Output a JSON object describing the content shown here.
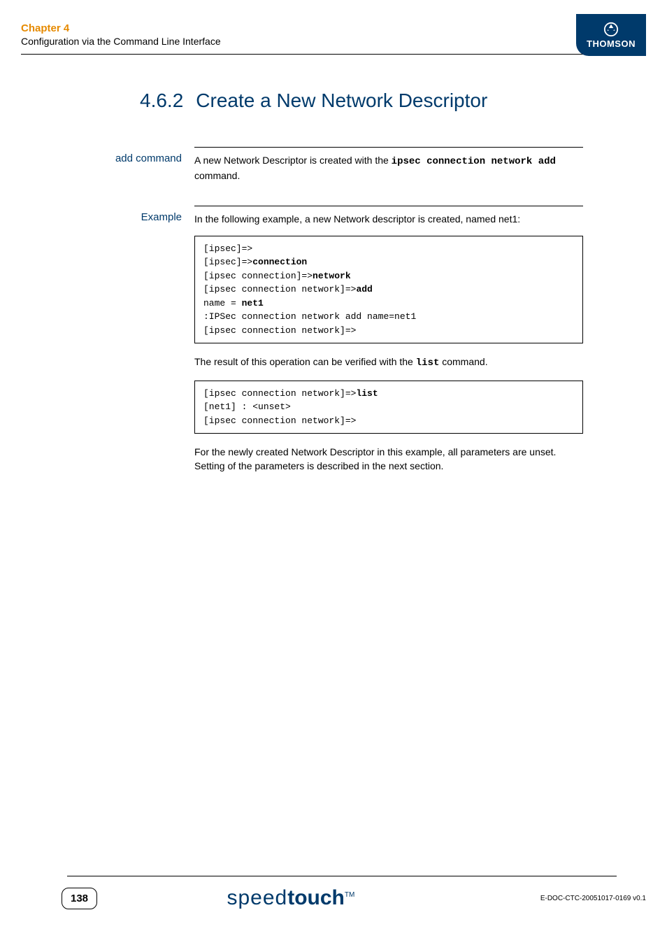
{
  "header": {
    "chapter_label": "Chapter 4",
    "chapter_subtitle": "Configuration via the Command Line Interface",
    "brand": "THOMSON"
  },
  "title": {
    "number": "4.6.2",
    "text": "Create a New Network Descriptor"
  },
  "sections": {
    "add_command": {
      "label": "add command",
      "para_prefix": "A new Network Descriptor is created with the ",
      "cmd": "ipsec connection network add",
      "para_suffix": " command."
    },
    "example": {
      "label": "Example",
      "intro": "In the following example, a new Network descriptor is created, named net1:",
      "code1": {
        "l1": "[ipsec]=>",
        "l2a": "[ipsec]=>",
        "l2b": "connection",
        "l3a": "[ipsec connection]=>",
        "l3b": "network",
        "l4a": "[ipsec connection network]=>",
        "l4b": "add",
        "l5a": "name = ",
        "l5b": "net1",
        "l6": ":IPSec connection network add name=net1",
        "l7": "[ipsec connection network]=>"
      },
      "mid_prefix": "The result of this operation can be verified with the ",
      "mid_cmd": "list",
      "mid_suffix": " command.",
      "code2": {
        "l1a": "[ipsec connection network]=>",
        "l1b": "list",
        "l2": "[net1] : <unset>",
        "l3": "[ipsec connection network]=>"
      },
      "outro": "For the newly created Network Descriptor in this example, all parameters are unset. Setting of the parameters is described in the next section."
    }
  },
  "footer": {
    "page": "138",
    "logo_light": "speed",
    "logo_bold": "touch",
    "logo_tm": "TM",
    "docid": "E-DOC-CTC-20051017-0169 v0.1"
  }
}
